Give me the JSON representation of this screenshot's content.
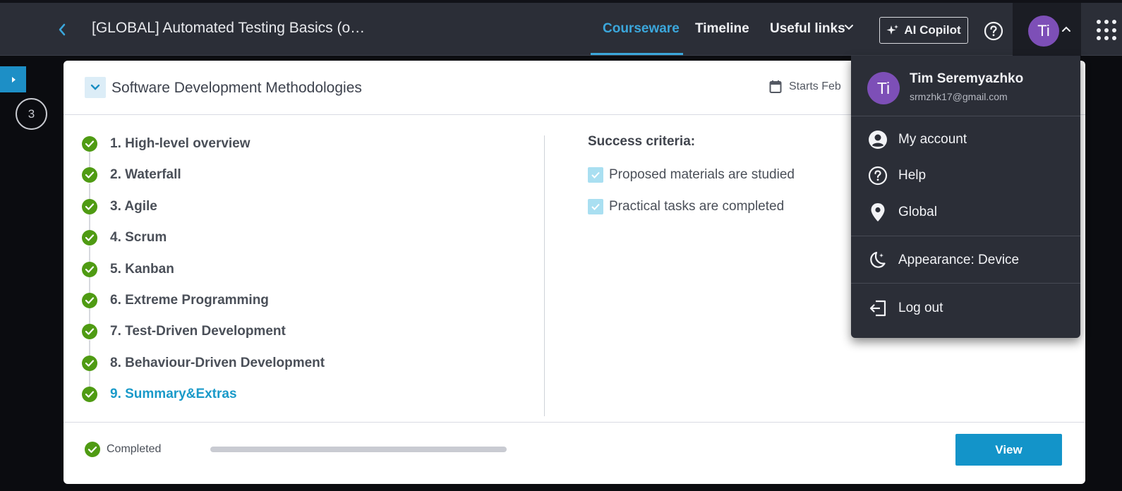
{
  "header": {
    "course_title": "[GLOBAL] Automated Testing Basics (o…",
    "nav": {
      "courseware": "Courseware",
      "timeline": "Timeline",
      "useful_links": "Useful links"
    },
    "ai_copilot": "AI Copilot",
    "avatar_initials": "Ti"
  },
  "sidebar": {
    "step_number": "3"
  },
  "section": {
    "title": "Software Development Methodologies",
    "starts": "Starts Feb"
  },
  "lessons": [
    {
      "label": "1. High-level overview",
      "completed": true
    },
    {
      "label": "2. Waterfall",
      "completed": true
    },
    {
      "label": "3. Agile",
      "completed": true
    },
    {
      "label": "4. Scrum",
      "completed": true
    },
    {
      "label": "5. Kanban",
      "completed": true
    },
    {
      "label": "6. Extreme Programming",
      "completed": true
    },
    {
      "label": "7. Test-Driven Development",
      "completed": true
    },
    {
      "label": "8. Behaviour-Driven Development",
      "completed": true
    },
    {
      "label": "9. Summary&Extras",
      "completed": true,
      "current": true
    }
  ],
  "criteria": {
    "title": "Success criteria:",
    "items": [
      {
        "label": "Proposed materials are studied",
        "checked": true
      },
      {
        "label": "Practical tasks are completed",
        "checked": true
      }
    ]
  },
  "footer": {
    "status": "Completed",
    "progress": 1.0,
    "view_button": "View"
  },
  "user_menu": {
    "avatar_initials": "Ti",
    "name": "Tim Seremyazhko",
    "email": "srmzhk17@gmail.com",
    "items": [
      {
        "label": "My account",
        "icon": "account-circle-icon"
      },
      {
        "label": "Help",
        "icon": "help-circle-icon"
      },
      {
        "label": "Global",
        "icon": "location-pin-icon"
      },
      {
        "label": "Appearance: Device",
        "icon": "moon-icon"
      },
      {
        "label": "Log out",
        "icon": "logout-icon"
      }
    ]
  },
  "colors": {
    "accent": "#3ba7dc",
    "success": "#4f9b13",
    "avatar": "#7d4fb7",
    "primary_button": "#1394c9",
    "header_bg": "#2b2e37"
  }
}
